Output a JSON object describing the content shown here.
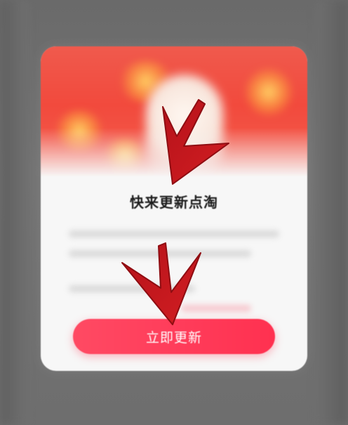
{
  "dialog": {
    "title": "快来更新点淘",
    "update_button_label": "立即更新"
  },
  "colors": {
    "overlay": "#6f6f6f",
    "banner_red": "#f24a3d",
    "button_red": "#ff3d5b",
    "arrow_red": "#c4161c"
  },
  "annotations": {
    "arrows": [
      "arrow-icon",
      "arrow-icon"
    ]
  }
}
